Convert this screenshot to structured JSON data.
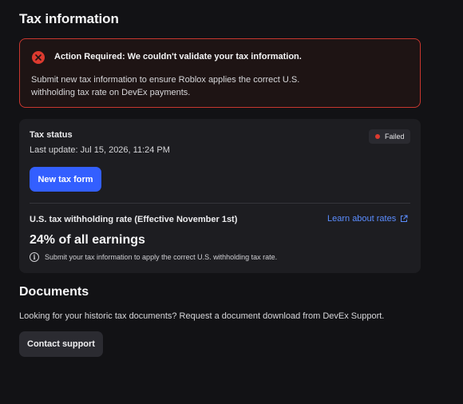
{
  "header": {
    "title": "Tax information"
  },
  "alert": {
    "icon": "error-x-icon",
    "title": "Action Required: We couldn't validate your tax information.",
    "body": "Submit new tax information to ensure Roblox applies the correct U.S. withholding tax rate on DevEx payments."
  },
  "tax_status": {
    "label": "Tax status",
    "last_update": "Last update: Jul 15, 2026, 11:24 PM",
    "badge": "Failed",
    "new_form_button": "New tax form"
  },
  "withholding": {
    "label": "U.S. tax withholding rate (Effective November 1st)",
    "learn_link": "Learn about rates",
    "link_icon": "external-link-icon",
    "rate": "24% of all earnings",
    "note_icon": "info-icon",
    "note": "Submit your tax information to apply the correct U.S. withholding tax rate."
  },
  "documents": {
    "title": "Documents",
    "text": "Looking for your historic tax documents? Request a document download from DevEx Support.",
    "contact_button": "Contact support"
  },
  "colors": {
    "background": "#121215",
    "card": "#1d1d21",
    "alert_border": "#c8372f",
    "error": "#dc3a2f",
    "primary": "#335fff",
    "link": "#5b8dff"
  }
}
